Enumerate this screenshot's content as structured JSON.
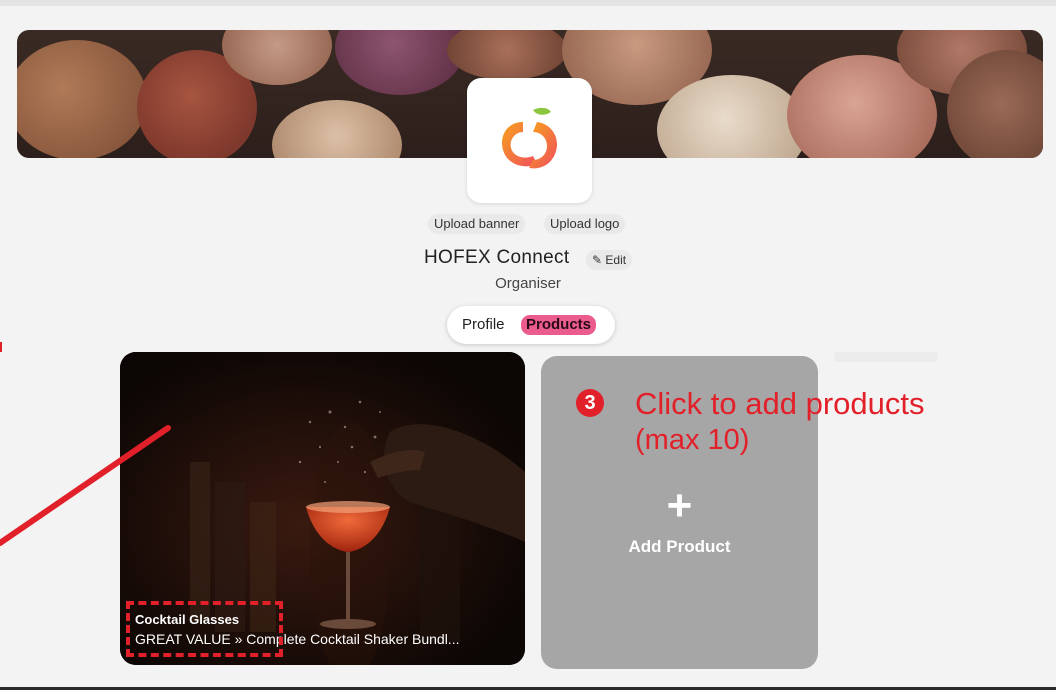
{
  "header": {
    "upload_banner_label": "Upload banner",
    "upload_logo_label": "Upload logo",
    "org_name": "HOFEX Connect",
    "edit_label": "Edit",
    "org_role": "Organiser"
  },
  "tabs": [
    {
      "label": "Profile",
      "active": false
    },
    {
      "label": "Products",
      "active": true
    }
  ],
  "products": [
    {
      "name": "Cocktail Glasses",
      "description": "GREAT VALUE » Complete Cocktail Shaker Bundl..."
    }
  ],
  "add_product": {
    "plus": "+",
    "label": "Add Product"
  },
  "annotation": {
    "step": "3",
    "line1": "Click to add products",
    "line2": "(max 10)"
  },
  "colors": {
    "accent_pink": "#ea5c8d",
    "annotation_red": "#e2202a",
    "add_card_gray": "#a6a6a6"
  },
  "icons": {
    "edit": "pencil-icon",
    "logo": "fruit-logo-icon"
  }
}
